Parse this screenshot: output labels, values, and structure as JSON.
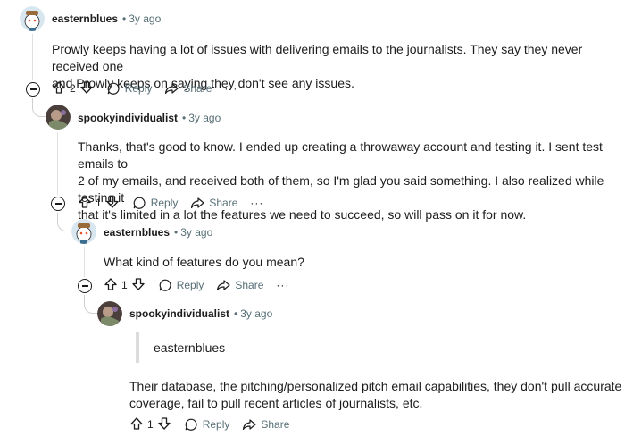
{
  "comments": [
    {
      "user": "easternblues",
      "age": "3y ago",
      "lines": [
        "Prowly keeps having a lot of issues with delivering emails to the journalists. They say they never received one",
        "and Prowly keeps on saying they don't see any issues."
      ],
      "votes": "2",
      "reply_label": "Reply",
      "share_label": "Share",
      "more_label": "···"
    },
    {
      "user": "spookyindividualist",
      "age": "3y ago",
      "lines": [
        "Thanks, that's good to know. I ended up creating a throwaway account and testing it. I sent test emails to",
        "2 of my emails, and received both of them, so I'm glad you said something. I also realized while testing it",
        "that it's limited in a lot the features we need to succeed, so will pass on it for now."
      ],
      "votes": "1",
      "reply_label": "Reply",
      "share_label": "Share",
      "more_label": "···"
    },
    {
      "user": "easternblues",
      "age": "3y ago",
      "lines": [
        "What kind of features do you mean?"
      ],
      "votes": "1",
      "reply_label": "Reply",
      "share_label": "Share",
      "more_label": "···"
    },
    {
      "user": "spookyindividualist",
      "age": "3y ago",
      "quote": "easternblues",
      "lines": [
        "Their database, the pitching/personalized pitch email capabilities, they don't pull accurate",
        "coverage, fail to pull recent articles of journalists, etc."
      ],
      "votes": "1",
      "reply_label": "Reply",
      "share_label": "Share"
    }
  ],
  "separator": "•",
  "colors": {
    "meta": "#576f76",
    "text": "#1c1c1c",
    "thread": "#e0e0e0"
  }
}
